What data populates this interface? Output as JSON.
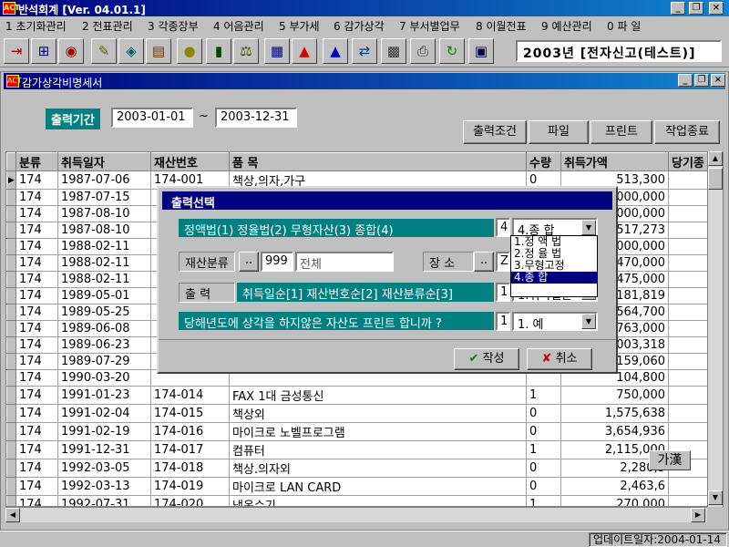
{
  "app": {
    "title": "반석회계 [Ver. 04.01.1]",
    "icon_text": "ACT"
  },
  "menu": [
    "1 초기화관리",
    "2 전표관리",
    "3 각종장부",
    "4 어음관리",
    "5 부가세",
    "6 감가상각",
    "7 부서별업무",
    "8 이월전표",
    "9 예산관리",
    "0 파 일"
  ],
  "toolbar": {
    "year_label": "2003년 [전자신고(테스트)]",
    "icons": [
      "exit-icon",
      "tree-icon",
      "globe-icon",
      "calc-icon",
      "tag-icon",
      "coin-icon",
      "book-icon",
      "scale-icon",
      "grid-icon",
      "up-arrow-red-icon",
      "up-arrow-blue-icon",
      "exchange-icon",
      "calculator-icon",
      "printer-icon",
      "refresh-icon",
      "card-icon"
    ]
  },
  "child": {
    "title": "감가상각비명세서",
    "period_label": "출력기간",
    "date_from": "2003-01-01",
    "tilde": "~",
    "date_to": "2003-12-31",
    "buttons": {
      "condition": "출력조건",
      "file": "파일",
      "print": "프린트",
      "end": "작업종료"
    }
  },
  "grid": {
    "columns": [
      "분류",
      "취득일자",
      "재산번호",
      "품    목",
      "수량",
      "취득가액",
      "당기종"
    ],
    "rows": [
      [
        "174",
        "1987-07-06",
        "174-001",
        "책상,의자,가구",
        "0",
        "513,300"
      ],
      [
        "174",
        "1987-07-15",
        "",
        "",
        "",
        "000,000"
      ],
      [
        "174",
        "1987-08-10",
        "",
        "",
        "",
        "000,000"
      ],
      [
        "174",
        "1987-08-10",
        "",
        "",
        "",
        "517,273"
      ],
      [
        "174",
        "1988-02-11",
        "",
        "",
        "",
        "000,000"
      ],
      [
        "174",
        "1988-02-11",
        "",
        "",
        "",
        "470,000"
      ],
      [
        "174",
        "1988-02-11",
        "",
        "",
        "",
        "475,000"
      ],
      [
        "174",
        "1989-05-01",
        "",
        "",
        "",
        "181,819"
      ],
      [
        "174",
        "1989-05-25",
        "",
        "",
        "",
        "564,700"
      ],
      [
        "174",
        "1989-06-08",
        "",
        "",
        "",
        "763,000"
      ],
      [
        "174",
        "1989-06-23",
        "",
        "",
        "",
        "003,318"
      ],
      [
        "174",
        "1989-07-29",
        "",
        "",
        "",
        "159,060"
      ],
      [
        "174",
        "1990-03-20",
        "",
        "",
        "",
        "104,800"
      ],
      [
        "174",
        "1991-01-23",
        "174-014",
        "FAX 1대 금성통신",
        "1",
        "750,000"
      ],
      [
        "174",
        "1991-02-04",
        "174-015",
        "책상외",
        "0",
        "1,575,638"
      ],
      [
        "174",
        "1991-02-19",
        "174-016",
        "마이크로 노벨프로그램",
        "0",
        "3,654,936"
      ],
      [
        "174",
        "1991-12-31",
        "174-017",
        "컴퓨터",
        "1",
        "2,115,000"
      ],
      [
        "174",
        "1992-03-05",
        "174-018",
        "책상.의자외",
        "0",
        "2,280,5"
      ],
      [
        "174",
        "1992-03-13",
        "174-019",
        "마이크로 LAN CARD",
        "0",
        "2,463,6"
      ],
      [
        "174",
        "1992-07-31",
        "174-020",
        "냉온수기",
        "1",
        "270,000"
      ]
    ]
  },
  "dialog": {
    "title": "출력선택",
    "method_label": "정액법(1) 정율법(2)   무형자산(3)   종합(4)",
    "method_value": "4",
    "method_select": "4.종   합",
    "method_options": [
      "1.정 액 법",
      "2.정 율 법",
      "3.무형고정",
      "4.종   합"
    ],
    "category_label": "재산분류",
    "category_code": "999",
    "category_name": "전체",
    "location_label": "장 소",
    "location_code": "Z",
    "output_label": "출    력",
    "output_desc": "취득일순[1] 재산번호순[2] 재산분류순[3]",
    "output_value": "1",
    "output_select": "1.취득일순",
    "question": "당해년도에 상각을 하지않은 자산도 프린트 합니까 ?",
    "question_value": "1",
    "question_select": "1.  예",
    "ok": "작성",
    "cancel": "취소",
    "dots": ".."
  },
  "ime": "가漢",
  "status": "업데이트일자:2004-01-14"
}
